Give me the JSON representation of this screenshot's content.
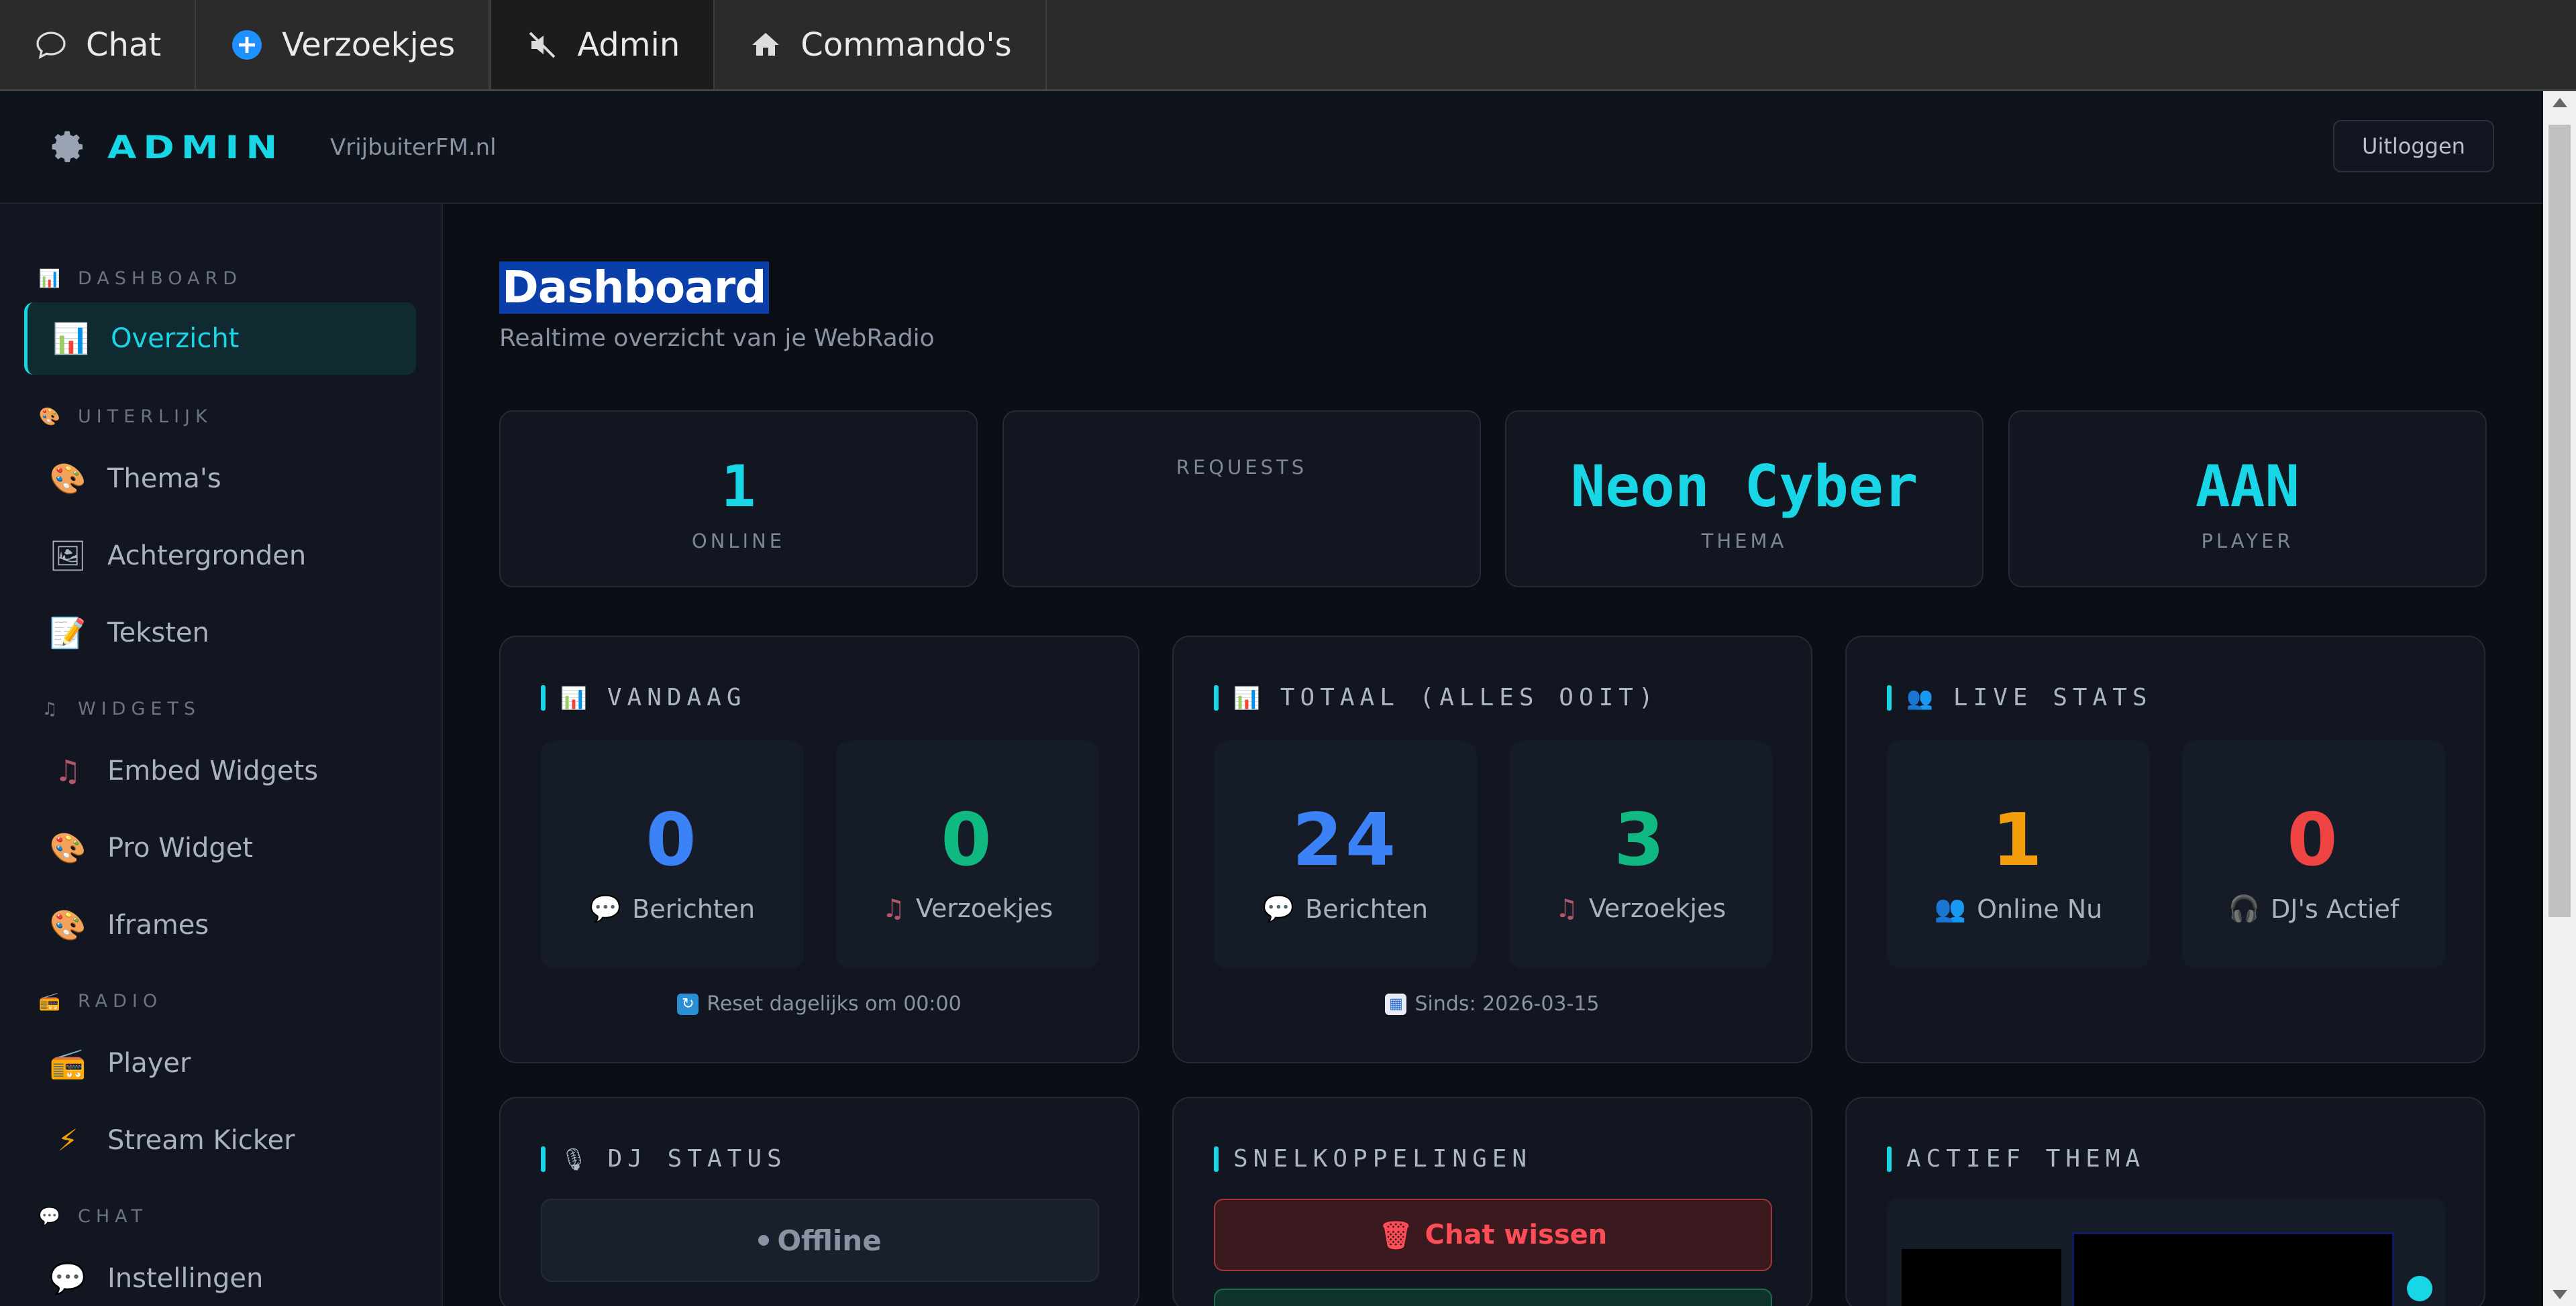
{
  "tabs": [
    {
      "label": "Chat",
      "icon": "chat-bubble-icon"
    },
    {
      "label": "Verzoekjes",
      "icon": "plus-circle-icon"
    },
    {
      "label": "Admin",
      "icon": "mute-speaker-icon",
      "active": true
    },
    {
      "label": "Commando's",
      "icon": "home-icon"
    }
  ],
  "header": {
    "brand": "ADMIN",
    "site": "VrijbuiterFM.nl",
    "logout": "Uitloggen"
  },
  "sidebar": {
    "sections": [
      {
        "title": "DASHBOARD",
        "icon": "chart-icon",
        "items": [
          {
            "label": "Overzicht",
            "icon": "chart-icon",
            "active": true
          }
        ]
      },
      {
        "title": "UITERLIJK",
        "icon": "palette-icon",
        "items": [
          {
            "label": "Thema's",
            "icon": "palette-icon"
          },
          {
            "label": "Achtergronden",
            "icon": "picture-icon"
          },
          {
            "label": "Teksten",
            "icon": "memo-icon"
          }
        ]
      },
      {
        "title": "WIDGETS",
        "icon": "music-note-icon",
        "items": [
          {
            "label": "Embed Widgets",
            "icon": "music-note-icon"
          },
          {
            "label": "Pro Widget",
            "icon": "palette-icon"
          },
          {
            "label": "Iframes",
            "icon": "palette-icon"
          }
        ]
      },
      {
        "title": "RADIO",
        "icon": "radio-icon",
        "items": [
          {
            "label": "Player",
            "icon": "radio-icon"
          },
          {
            "label": "Stream Kicker",
            "icon": "lightning-icon"
          }
        ]
      },
      {
        "title": "CHAT",
        "icon": "speech-bubble-icon",
        "items": [
          {
            "label": "Instellingen",
            "icon": "speech-bubble-icon"
          }
        ]
      }
    ]
  },
  "main": {
    "title": "Dashboard",
    "subtitle": "Realtime overzicht van je WebRadio",
    "stats": [
      {
        "value": "1",
        "label": "ONLINE"
      },
      {
        "value": "",
        "label": "REQUESTS"
      },
      {
        "value": "Neon Cyber",
        "label": "THEMA"
      },
      {
        "value": "AAN",
        "label": "PLAYER"
      }
    ],
    "vandaag": {
      "title": "VANDAAG",
      "tiles": [
        {
          "value": "0",
          "label": "Berichten",
          "icon": "speech-bubble-icon",
          "color": "#3b82f6"
        },
        {
          "value": "0",
          "label": "Verzoekjes",
          "icon": "music-note-icon",
          "color": "#10b981"
        }
      ],
      "footer": "Reset dagelijks om 00:00"
    },
    "totaal": {
      "title": "TOTAAL (ALLES OOIT)",
      "tiles": [
        {
          "value": "24",
          "label": "Berichten",
          "icon": "speech-bubble-icon",
          "color": "#3b82f6"
        },
        {
          "value": "3",
          "label": "Verzoekjes",
          "icon": "music-note-icon",
          "color": "#10b981"
        }
      ],
      "footer": "Sinds: 2026-03-15"
    },
    "live": {
      "title": "LIVE STATS",
      "tiles": [
        {
          "value": "1",
          "label": "Online Nu",
          "icon": "people-icon",
          "color": "#f59e0b"
        },
        {
          "value": "0",
          "label": "DJ's Actief",
          "icon": "headphones-icon",
          "color": "#ef4444"
        }
      ]
    },
    "dj": {
      "title": "DJ STATUS",
      "status": "Offline"
    },
    "links": {
      "title": "SNELKOPPELINGEN",
      "clear_chat": "Chat wissen"
    },
    "theme": {
      "title": "ACTIEF THEMA"
    }
  },
  "colors": {
    "accent": "#18d6e6",
    "danger": "#ff4d57"
  }
}
